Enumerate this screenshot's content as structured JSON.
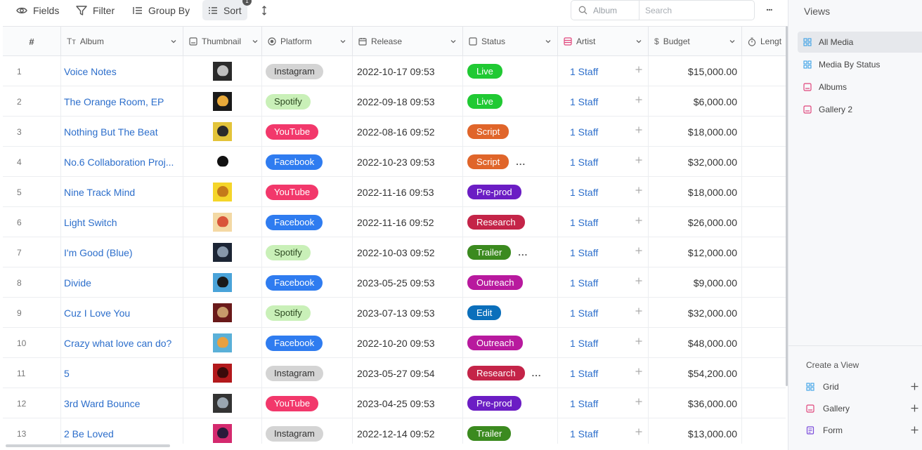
{
  "toolbar": {
    "fields_label": "Fields",
    "filter_label": "Filter",
    "group_by_label": "Group By",
    "sort_label": "Sort",
    "sort_count": "1",
    "search_field_label": "Album",
    "search_placeholder": "Search",
    "more_label": "..."
  },
  "columns": {
    "num": "#",
    "album": "Album",
    "thumbnail": "Thumbnail",
    "platform": "Platform",
    "release": "Release",
    "status": "Status",
    "artist": "Artist",
    "budget": "Budget",
    "length": "Lengt"
  },
  "colors": {
    "link": "#2c6ecb",
    "platform": {
      "Instagram": {
        "bg": "#d4d4d4",
        "fg": "#333333"
      },
      "Spotify": {
        "bg": "#c9f0b8",
        "fg": "#2e4a22"
      },
      "YouTube": {
        "bg": "#f2386b",
        "fg": "#ffffff"
      },
      "Facebook": {
        "bg": "#2f7cf0",
        "fg": "#ffffff"
      }
    },
    "status": {
      "Live": "#20c933",
      "Script": "#e0652a",
      "Pre-prod": "#6b1dc4",
      "Research": "#c42448",
      "Trailer": "#3b8a1f",
      "Outreach": "#b8199e",
      "Edit": "#0b6fbb"
    }
  },
  "rows": [
    {
      "num": "1",
      "album": "Voice Notes",
      "thumb": [
        "#2a2a2a",
        "#bfbfbf"
      ],
      "platform": "Instagram",
      "release": "2022-10-17 09:53",
      "status": "Live",
      "more": "",
      "artist": "1 Staff",
      "budget": "$15,000.00"
    },
    {
      "num": "2",
      "album": "The Orange Room, EP",
      "thumb": [
        "#1a1a1a",
        "#e8a93a"
      ],
      "platform": "Spotify",
      "release": "2022-09-18 09:53",
      "status": "Live",
      "more": "",
      "artist": "1 Staff",
      "budget": "$6,000.00"
    },
    {
      "num": "3",
      "album": "Nothing But The Beat",
      "thumb": [
        "#e3c43a",
        "#2b2b2b"
      ],
      "platform": "YouTube",
      "release": "2022-08-16 09:52",
      "status": "Script",
      "more": "",
      "artist": "1 Staff",
      "budget": "$18,000.00"
    },
    {
      "num": "4",
      "album": "No.6 Collaboration Proj...",
      "thumb": [
        "#ffffff",
        "#111111"
      ],
      "platform": "Facebook",
      "release": "2022-10-23 09:53",
      "status": "Script",
      "more": "...",
      "artist": "1 Staff",
      "budget": "$32,000.00"
    },
    {
      "num": "5",
      "album": "Nine Track Mind",
      "thumb": [
        "#f5d52a",
        "#c47a1a"
      ],
      "platform": "YouTube",
      "release": "2022-11-16 09:53",
      "status": "Pre-prod",
      "more": "",
      "artist": "1 Staff",
      "budget": "$18,000.00"
    },
    {
      "num": "6",
      "album": "Light Switch",
      "thumb": [
        "#f3d9a4",
        "#d9553a"
      ],
      "platform": "Facebook",
      "release": "2022-11-16 09:52",
      "status": "Research",
      "more": "",
      "artist": "1 Staff",
      "budget": "$26,000.00"
    },
    {
      "num": "7",
      "album": "I'm Good (Blue)",
      "thumb": [
        "#1c2535",
        "#8797aa"
      ],
      "platform": "Spotify",
      "release": "2022-10-03 09:52",
      "status": "Trailer",
      "more": "...",
      "artist": "1 Staff",
      "budget": "$12,000.00"
    },
    {
      "num": "8",
      "album": "Divide",
      "thumb": [
        "#4aa3d9",
        "#1a1a1a"
      ],
      "platform": "Facebook",
      "release": "2023-05-25 09:53",
      "status": "Outreach",
      "more": "",
      "artist": "1 Staff",
      "budget": "$9,000.00"
    },
    {
      "num": "9",
      "album": "Cuz I Love You",
      "thumb": [
        "#6a1a1a",
        "#c79a6a"
      ],
      "platform": "Spotify",
      "release": "2023-07-13 09:53",
      "status": "Edit",
      "more": "",
      "artist": "1 Staff",
      "budget": "$32,000.00"
    },
    {
      "num": "10",
      "album": "Crazy what love can do?",
      "thumb": [
        "#5ab0d8",
        "#e8a040"
      ],
      "platform": "Facebook",
      "release": "2022-10-20 09:53",
      "status": "Outreach",
      "more": "",
      "artist": "1 Staff",
      "budget": "$48,000.00"
    },
    {
      "num": "11",
      "album": "5",
      "thumb": [
        "#b3191c",
        "#3a0a0a"
      ],
      "platform": "Instagram",
      "release": "2023-05-27 09:54",
      "status": "Research",
      "more": "...",
      "artist": "1 Staff",
      "budget": "$54,200.00"
    },
    {
      "num": "12",
      "album": "3rd Ward Bounce",
      "thumb": [
        "#333333",
        "#9aa6b0"
      ],
      "platform": "YouTube",
      "release": "2023-04-25 09:53",
      "status": "Pre-prod",
      "more": "",
      "artist": "1 Staff",
      "budget": "$36,000.00"
    },
    {
      "num": "13",
      "album": "2 Be Loved",
      "thumb": [
        "#d42a6e",
        "#2a1a3a"
      ],
      "platform": "Instagram",
      "release": "2022-12-14 09:52",
      "status": "Trailer",
      "more": "",
      "artist": "1 Staff",
      "budget": "$13,000.00"
    }
  ],
  "views": {
    "title": "Views",
    "items": [
      {
        "label": "All Media",
        "icon": "grid-icon",
        "active": true
      },
      {
        "label": "Media By Status",
        "icon": "grid-icon",
        "active": false
      },
      {
        "label": "Albums",
        "icon": "gallery-icon",
        "active": false
      },
      {
        "label": "Gallery 2",
        "icon": "gallery-icon",
        "active": false
      }
    ]
  },
  "create": {
    "title": "Create a View",
    "items": [
      {
        "label": "Grid",
        "icon": "grid-icon"
      },
      {
        "label": "Gallery",
        "icon": "gallery-icon"
      },
      {
        "label": "Form",
        "icon": "form-icon"
      }
    ]
  }
}
